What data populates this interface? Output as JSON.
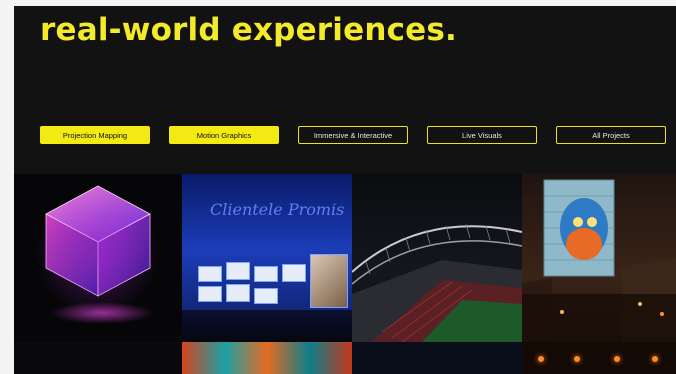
{
  "hero": {
    "headline": "real-world experiences."
  },
  "filters": [
    {
      "label": "Projection Mapping",
      "active": true
    },
    {
      "label": "Motion Graphics",
      "active": true
    },
    {
      "label": "Immersive & Interactive",
      "active": false
    },
    {
      "label": "Live Visuals",
      "active": false
    },
    {
      "label": "All Projects",
      "active": false
    }
  ],
  "colors": {
    "accent": "#f2ea12",
    "background": "#121212"
  },
  "gallery": {
    "concert_script": "Clientele Promis"
  }
}
